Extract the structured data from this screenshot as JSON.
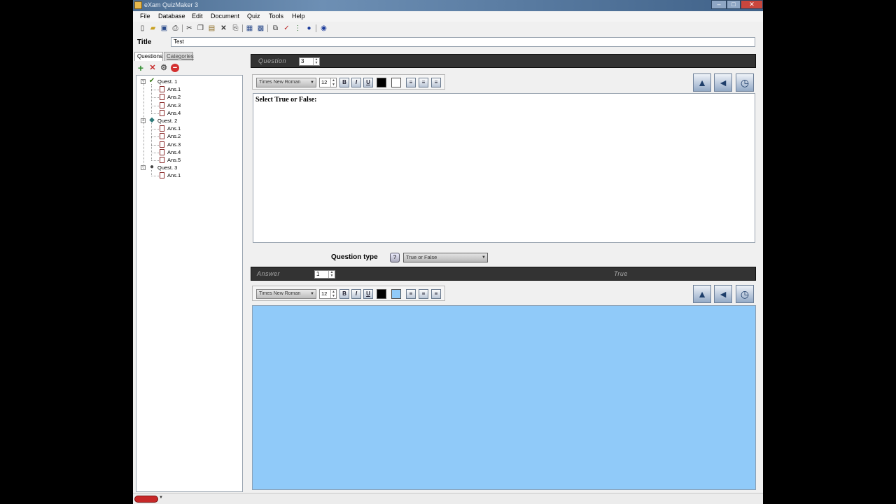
{
  "window": {
    "title": "eXam QuizMaker 3",
    "controls": {
      "minimize": "–",
      "maximize": "□",
      "close": "✕"
    }
  },
  "menu": [
    "File",
    "Database",
    "Edit",
    "Document",
    "Quiz",
    "Tools",
    "Help"
  ],
  "toolbar_icons": [
    "new-icon",
    "open-icon",
    "save-icon",
    "print-icon",
    "cut-icon",
    "copy-icon",
    "paste-icon",
    "delete-icon",
    "preview-icon",
    "print-quiz-icon",
    "grid-icon",
    "export-icon",
    "spell-check-icon",
    "traffic-light-icon",
    "globe-icon",
    "help-icon"
  ],
  "title_field": {
    "label": "Title",
    "value": "Test"
  },
  "tabs": {
    "questions": "Questions",
    "categories": "Categories"
  },
  "left_toolbar": {
    "add": "+",
    "remove": "✕",
    "settings": "⚙",
    "stop": "−"
  },
  "tree": [
    {
      "label": "Quest. 1",
      "icon": "check-icon",
      "icon_glyph": "✔",
      "icon_color": "#3a7a1a",
      "answers": [
        "Ans.1",
        "Ans.2",
        "Ans.3",
        "Ans.4"
      ]
    },
    {
      "label": "Quest. 2",
      "icon": "diamond-icon",
      "icon_glyph": "◆",
      "icon_color": "#2f7a7a",
      "answers": [
        "Ans.1",
        "Ans.2",
        "Ans.3",
        "Ans.4",
        "Ans.5"
      ]
    },
    {
      "label": "Quest. 3",
      "icon": "ball-icon",
      "icon_glyph": "●",
      "icon_color": "#444444",
      "answers": [
        "Ans.1"
      ]
    }
  ],
  "question_panel": {
    "header_label": "Question",
    "number": "3",
    "font": "Times New Roman",
    "font_size": "12",
    "text": "Select True or False:"
  },
  "question_type": {
    "label": "Question type",
    "help": "?",
    "value": "True or False"
  },
  "answer_panel": {
    "header_label": "Answer",
    "number": "1",
    "true_label": "True",
    "font": "Times New Roman",
    "font_size": "12",
    "background_color": "#90caf9"
  },
  "format_buttons": {
    "bold": "B",
    "italic": "I",
    "underline": "U"
  },
  "colors": {
    "text_black": "#000000",
    "bg_white": "#ffffff",
    "bg_blue": "#90caf9"
  }
}
